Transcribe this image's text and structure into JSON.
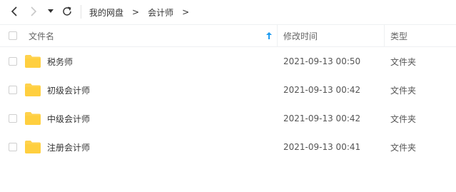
{
  "toolbar": {
    "breadcrumb": [
      "我的网盘",
      "会计师"
    ],
    "arrow": ">"
  },
  "columns": {
    "name": "文件名",
    "modified": "修改时间",
    "type": "类型"
  },
  "files": [
    {
      "name": "税务师",
      "modified": "2021-09-13 00:50",
      "type": "文件夹"
    },
    {
      "name": "初级会计师",
      "modified": "2021-09-13 00:42",
      "type": "文件夹"
    },
    {
      "name": "中级会计师",
      "modified": "2021-09-13 00:42",
      "type": "文件夹"
    },
    {
      "name": "注册会计师",
      "modified": "2021-09-13 00:41",
      "type": "文件夹"
    }
  ],
  "colors": {
    "folder": "#FFD24D",
    "sort_arrow": "#1E9BF0"
  },
  "icons": {
    "back": "chevron-left-icon",
    "forward": "chevron-right-icon",
    "dropdown": "caret-down-icon",
    "refresh": "refresh-icon",
    "sort": "sort-ascending-icon",
    "folder": "folder-icon"
  }
}
